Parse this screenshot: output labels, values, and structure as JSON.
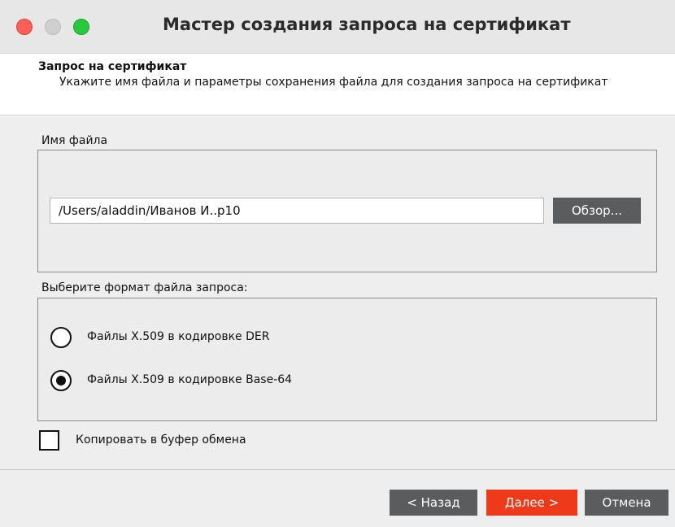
{
  "window": {
    "title": "Мастер создания запроса на сертификат"
  },
  "header": {
    "title": "Запрос на сертификат",
    "description": "Укажите имя файла и параметры сохранения файла для создания запроса на сертификат"
  },
  "file_group": {
    "label": "Имя файла",
    "path_value": "/Users/aladdin/Иванов И..p10",
    "browse_label": "Обзор..."
  },
  "format_group": {
    "label": "Выберите формат файла запроса:",
    "options": [
      {
        "label": "Файлы X.509 в кодировке DER",
        "selected": false
      },
      {
        "label": "Файлы X.509 в кодировке Base-64",
        "selected": true
      }
    ]
  },
  "clipboard": {
    "label": "Копировать в буфер обмена",
    "checked": false
  },
  "footer": {
    "back_label": "< Назад",
    "next_label": "Далее >",
    "cancel_label": "Отмена"
  },
  "colors": {
    "accent": "#ec3a1b",
    "dark_button": "#5a5c5e"
  }
}
